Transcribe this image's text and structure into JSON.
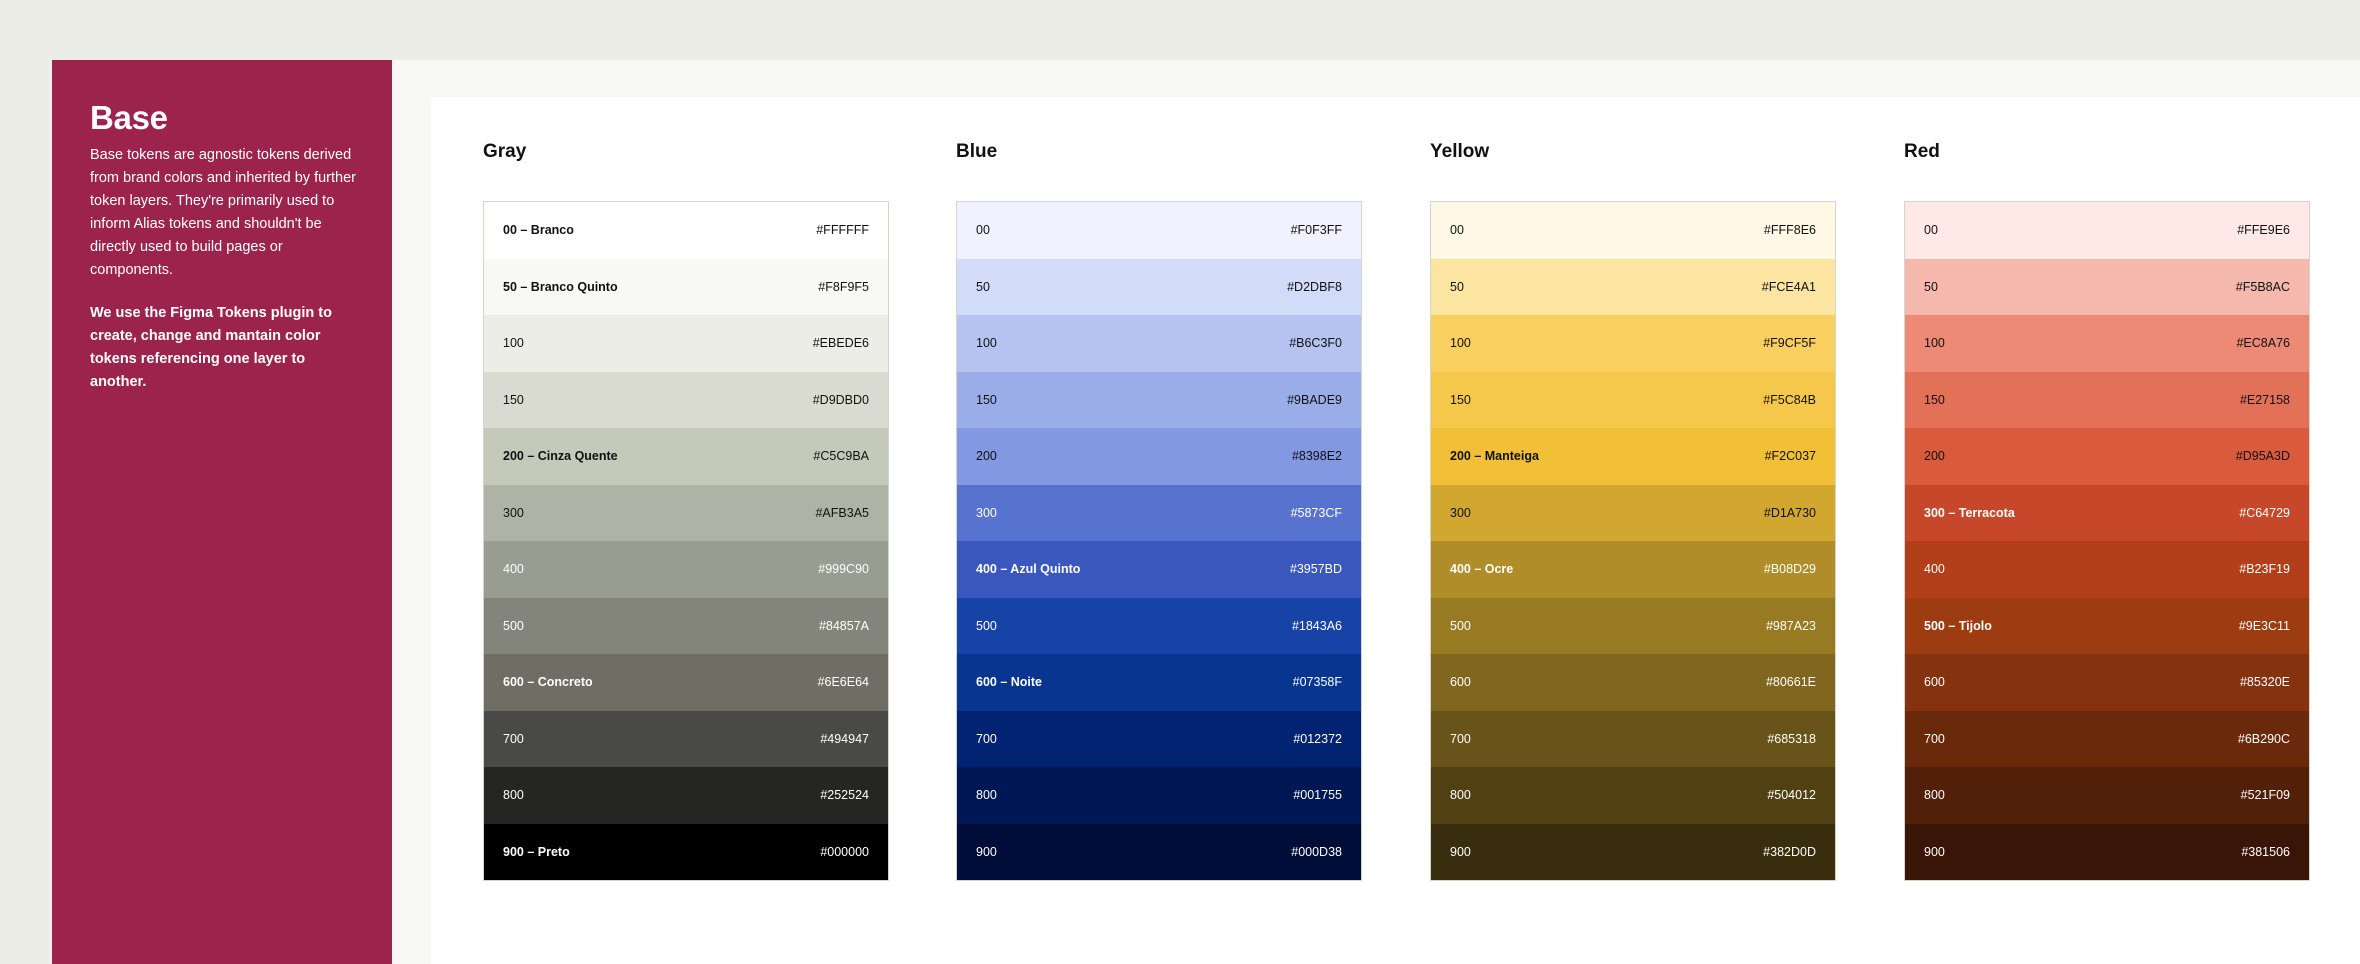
{
  "sidebar": {
    "title": "Base",
    "description": "Base tokens are agnostic tokens derived from brand colors and inherited by further token layers. They're primarily used to inform Alias tokens and shouldn't be directly used to build pages or components.",
    "note": "We use the Figma Tokens plugin to create, change and mantain color tokens referencing one layer to another."
  },
  "palettes": [
    {
      "title": "Gray",
      "swatches": [
        {
          "label": "00 – Branco",
          "hex": "#FFFFFF",
          "named": true,
          "text": "#111111"
        },
        {
          "label": "50 – Branco Quinto",
          "hex": "#F8F9F5",
          "named": true,
          "text": "#111111"
        },
        {
          "label": "100",
          "hex": "#EBEDE6",
          "named": false,
          "text": "#111111"
        },
        {
          "label": "150",
          "hex": "#D9DBD0",
          "named": false,
          "text": "#111111"
        },
        {
          "label": "200 – Cinza Quente",
          "hex": "#C5C9BA",
          "named": true,
          "text": "#111111"
        },
        {
          "label": "300",
          "hex": "#AFB3A5",
          "named": false,
          "text": "#111111"
        },
        {
          "label": "400",
          "hex": "#999C90",
          "named": false,
          "text": "#FFFFFF"
        },
        {
          "label": "500",
          "hex": "#84857A",
          "named": false,
          "text": "#FFFFFF"
        },
        {
          "label": "600 – Concreto",
          "hex": "#6E6E64",
          "named": true,
          "text": "#FFFFFF"
        },
        {
          "label": "700",
          "hex": "#494947",
          "named": false,
          "text": "#FFFFFF"
        },
        {
          "label": "800",
          "hex": "#252524",
          "named": false,
          "text": "#FFFFFF"
        },
        {
          "label": "900 – Preto",
          "hex": "#000000",
          "named": true,
          "text": "#FFFFFF"
        }
      ]
    },
    {
      "title": "Blue",
      "swatches": [
        {
          "label": "00",
          "hex": "#F0F3FF",
          "named": false,
          "text": "#111111"
        },
        {
          "label": "50",
          "hex": "#D2DBF8",
          "named": false,
          "text": "#111111"
        },
        {
          "label": "100",
          "hex": "#B6C3F0",
          "named": false,
          "text": "#111111"
        },
        {
          "label": "150",
          "hex": "#9BADE9",
          "named": false,
          "text": "#111111"
        },
        {
          "label": "200",
          "hex": "#8398E2",
          "named": false,
          "text": "#111111"
        },
        {
          "label": "300",
          "hex": "#5873CF",
          "named": false,
          "text": "#FFFFFF"
        },
        {
          "label": "400 – Azul Quinto",
          "hex": "#3957BD",
          "named": true,
          "text": "#FFFFFF"
        },
        {
          "label": "500",
          "hex": "#1843A6",
          "named": false,
          "text": "#FFFFFF"
        },
        {
          "label": "600 – Noite",
          "hex": "#07358F",
          "named": true,
          "text": "#FFFFFF"
        },
        {
          "label": "700",
          "hex": "#012372",
          "named": false,
          "text": "#FFFFFF"
        },
        {
          "label": "800",
          "hex": "#001755",
          "named": false,
          "text": "#FFFFFF"
        },
        {
          "label": "900",
          "hex": "#000D38",
          "named": false,
          "text": "#FFFFFF"
        }
      ]
    },
    {
      "title": "Yellow",
      "swatches": [
        {
          "label": "00",
          "hex": "#FFF8E6",
          "named": false,
          "text": "#111111"
        },
        {
          "label": "50",
          "hex": "#FCE4A1",
          "named": false,
          "text": "#111111"
        },
        {
          "label": "100",
          "hex": "#F9CF5F",
          "named": false,
          "text": "#111111"
        },
        {
          "label": "150",
          "hex": "#F5C84B",
          "named": false,
          "text": "#111111"
        },
        {
          "label": "200 – Manteiga",
          "hex": "#F2C037",
          "named": true,
          "text": "#111111"
        },
        {
          "label": "300",
          "hex": "#D1A730",
          "named": false,
          "text": "#111111"
        },
        {
          "label": "400 – Ocre",
          "hex": "#B08D29",
          "named": true,
          "text": "#FFFFFF"
        },
        {
          "label": "500",
          "hex": "#987A23",
          "named": false,
          "text": "#FFFFFF"
        },
        {
          "label": "600",
          "hex": "#80661E",
          "named": false,
          "text": "#FFFFFF"
        },
        {
          "label": "700",
          "hex": "#685318",
          "named": false,
          "text": "#FFFFFF"
        },
        {
          "label": "800",
          "hex": "#504012",
          "named": false,
          "text": "#FFFFFF"
        },
        {
          "label": "900",
          "hex": "#382D0D",
          "named": false,
          "text": "#FFFFFF"
        }
      ]
    },
    {
      "title": "Red",
      "swatches": [
        {
          "label": "00",
          "hex": "#FFE9E6",
          "named": false,
          "text": "#111111"
        },
        {
          "label": "50",
          "hex": "#F5B8AC",
          "named": false,
          "text": "#111111"
        },
        {
          "label": "100",
          "hex": "#EC8A76",
          "named": false,
          "text": "#111111"
        },
        {
          "label": "150",
          "hex": "#E27158",
          "named": false,
          "text": "#111111"
        },
        {
          "label": "200",
          "hex": "#D95A3D",
          "named": false,
          "text": "#111111"
        },
        {
          "label": "300 – Terracota",
          "hex": "#C64729",
          "named": true,
          "text": "#FFFFFF"
        },
        {
          "label": "400",
          "hex": "#B23F19",
          "named": false,
          "text": "#FFFFFF"
        },
        {
          "label": "500 – Tijolo",
          "hex": "#9E3C11",
          "named": true,
          "text": "#FFFFFF"
        },
        {
          "label": "600",
          "hex": "#85320E",
          "named": false,
          "text": "#FFFFFF"
        },
        {
          "label": "700",
          "hex": "#6B290C",
          "named": false,
          "text": "#FFFFFF"
        },
        {
          "label": "800",
          "hex": "#521F09",
          "named": false,
          "text": "#FFFFFF"
        },
        {
          "label": "900",
          "hex": "#381506",
          "named": false,
          "text": "#FFFFFF"
        }
      ]
    }
  ]
}
